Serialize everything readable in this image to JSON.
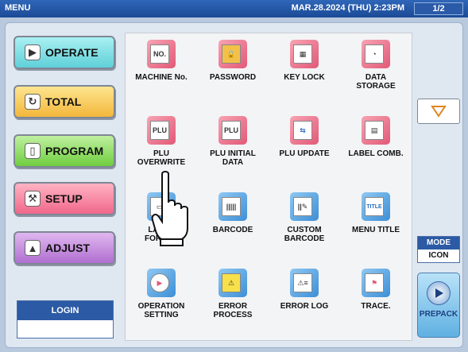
{
  "titlebar": {
    "menu": "MENU",
    "datetime": "MAR.28.2024 (THU)  2:23PM",
    "page": "1/2"
  },
  "side": {
    "operate": "OPERATE",
    "total": "TOTAL",
    "program": "PROGRAM",
    "setup": "SETUP",
    "adjust": "ADJUST"
  },
  "login": {
    "label": "LOGIN",
    "value": ""
  },
  "mode": {
    "label": "MODE",
    "value": "ICON"
  },
  "prepack": "PREPACK",
  "tiles": [
    {
      "line1": "MACHINE No.",
      "line2": "",
      "icon": "machine-no-icon"
    },
    {
      "line1": "PASSWORD",
      "line2": "",
      "icon": "lock-icon"
    },
    {
      "line1": "KEY LOCK",
      "line2": "",
      "icon": "key-lock-icon"
    },
    {
      "line1": "DATA",
      "line2": "STORAGE",
      "icon": "data-storage-icon"
    },
    {
      "line1": "PLU",
      "line2": "OVERWRITE",
      "icon": "plu-overwrite-icon"
    },
    {
      "line1": "PLU INITIAL",
      "line2": "DATA",
      "icon": "plu-initial-icon"
    },
    {
      "line1": "PLU UPDATE",
      "line2": "",
      "icon": "plu-update-icon"
    },
    {
      "line1": "LABEL COMB.",
      "line2": "",
      "icon": "label-comb-icon"
    },
    {
      "line1": "LABEL",
      "line2": "FORMAT",
      "icon": "label-format-icon"
    },
    {
      "line1": "BARCODE",
      "line2": "",
      "icon": "barcode-icon"
    },
    {
      "line1": "CUSTOM",
      "line2": "BARCODE",
      "icon": "custom-barcode-icon"
    },
    {
      "line1": "MENU TITLE",
      "line2": "",
      "icon": "menu-title-icon"
    },
    {
      "line1": "OPERATION",
      "line2": "SETTING",
      "icon": "operation-setting-icon"
    },
    {
      "line1": "ERROR",
      "line2": "PROCESS",
      "icon": "warning-icon"
    },
    {
      "line1": "ERROR LOG",
      "line2": "",
      "icon": "error-log-icon"
    },
    {
      "line1": "TRACE.",
      "line2": "",
      "icon": "trace-icon"
    }
  ],
  "colors": {
    "title_bar": "#1b4a96",
    "accent_red": "#e25977",
    "accent_blue": "#3d8fd6"
  }
}
